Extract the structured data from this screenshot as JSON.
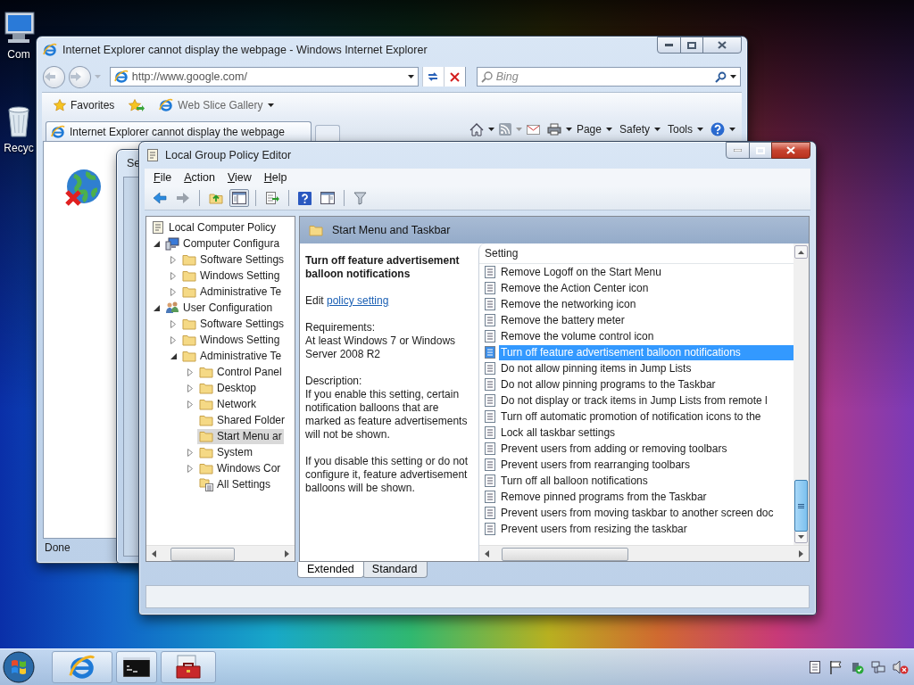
{
  "desktop_icons": [
    {
      "label": "Com",
      "kind": "computer"
    },
    {
      "label": "Recyc",
      "kind": "recycle-bin"
    }
  ],
  "browser": {
    "title": "Internet Explorer cannot display the webpage - Windows Internet Explorer",
    "address": "http://www.google.com/",
    "search_placeholder": "Bing",
    "favorites": "Favorites",
    "web_slice": "Web Slice Gallery",
    "tab": "Internet Explorer cannot display the webpage",
    "commands": [
      "Page",
      "Safety",
      "Tools"
    ],
    "status": "Done"
  },
  "dialog_behind": {
    "title": "Se"
  },
  "editor": {
    "title": "Local Group Policy Editor",
    "menu": [
      "File",
      "Action",
      "View",
      "Help"
    ],
    "tree": [
      {
        "label": "Local Computer Policy",
        "kind": "policy",
        "selected": false,
        "children": [
          {
            "label": "Computer Configura",
            "kind": "computer",
            "selected": false,
            "expanded": true,
            "children": [
              {
                "label": "Software Settings",
                "kind": "folder",
                "selected": false,
                "expanded": false
              },
              {
                "label": "Windows Setting",
                "kind": "folder",
                "selected": false,
                "expanded": false
              },
              {
                "label": "Administrative Te",
                "kind": "folder",
                "selected": false,
                "expanded": false
              }
            ]
          },
          {
            "label": "User Configuration",
            "kind": "users",
            "selected": false,
            "expanded": true,
            "children": [
              {
                "label": "Software Settings",
                "kind": "folder",
                "selected": false,
                "expanded": false
              },
              {
                "label": "Windows Setting",
                "kind": "folder",
                "selected": false,
                "expanded": false
              },
              {
                "label": "Administrative Te",
                "kind": "folder",
                "selected": false,
                "expanded": true,
                "children": [
                  {
                    "label": "Control Panel",
                    "kind": "folder",
                    "selected": false,
                    "expanded": false
                  },
                  {
                    "label": "Desktop",
                    "kind": "folder",
                    "selected": false,
                    "expanded": false
                  },
                  {
                    "label": "Network",
                    "kind": "folder",
                    "selected": false,
                    "expanded": false
                  },
                  {
                    "label": "Shared Folder",
                    "kind": "folder",
                    "selected": false
                  },
                  {
                    "label": "Start Menu ar",
                    "kind": "folder",
                    "selected": true
                  },
                  {
                    "label": "System",
                    "kind": "folder",
                    "selected": false,
                    "expanded": false
                  },
                  {
                    "label": "Windows Cor",
                    "kind": "folder",
                    "selected": false,
                    "expanded": false
                  },
                  {
                    "label": "All Settings",
                    "kind": "all-settings",
                    "selected": false
                  }
                ]
              }
            ]
          }
        ]
      }
    ],
    "header": "Start Menu and Taskbar",
    "policy_title": "Turn off feature advertisement balloon notifications",
    "edit_prefix": "Edit",
    "edit_link": "policy setting",
    "requirements_label": "Requirements:",
    "requirements": "At least Windows 7 or Windows Server 2008 R2",
    "description_label": "Description:",
    "description": [
      "If you enable this setting, certain notification balloons that are marked as feature advertisements will not be shown.",
      "If you disable this setting or do not configure it, feature advertisement balloons will be shown."
    ],
    "column": "Setting",
    "settings": [
      {
        "label": "Remove Logoff on the Start Menu",
        "selected": false
      },
      {
        "label": "Remove the Action Center icon",
        "selected": false
      },
      {
        "label": "Remove the networking icon",
        "selected": false
      },
      {
        "label": "Remove the battery meter",
        "selected": false
      },
      {
        "label": "Remove the volume control icon",
        "selected": false
      },
      {
        "label": "Turn off feature advertisement balloon notifications",
        "selected": true
      },
      {
        "label": "Do not allow pinning items in Jump Lists",
        "selected": false
      },
      {
        "label": "Do not allow pinning programs to the Taskbar",
        "selected": false
      },
      {
        "label": "Do not display or track items in Jump Lists from remote l",
        "selected": false
      },
      {
        "label": "Turn off automatic promotion of notification icons to the",
        "selected": false
      },
      {
        "label": "Lock all taskbar settings",
        "selected": false
      },
      {
        "label": "Prevent users from adding or removing toolbars",
        "selected": false
      },
      {
        "label": "Prevent users from rearranging toolbars",
        "selected": false
      },
      {
        "label": "Turn off all balloon notifications",
        "selected": false
      },
      {
        "label": "Remove pinned programs from the Taskbar",
        "selected": false
      },
      {
        "label": "Prevent users from moving taskbar to another screen doc",
        "selected": false
      },
      {
        "label": "Prevent users from resizing the taskbar",
        "selected": false
      }
    ],
    "tabs": [
      {
        "label": "Extended",
        "selected": true
      },
      {
        "label": "Standard",
        "selected": false
      }
    ]
  }
}
